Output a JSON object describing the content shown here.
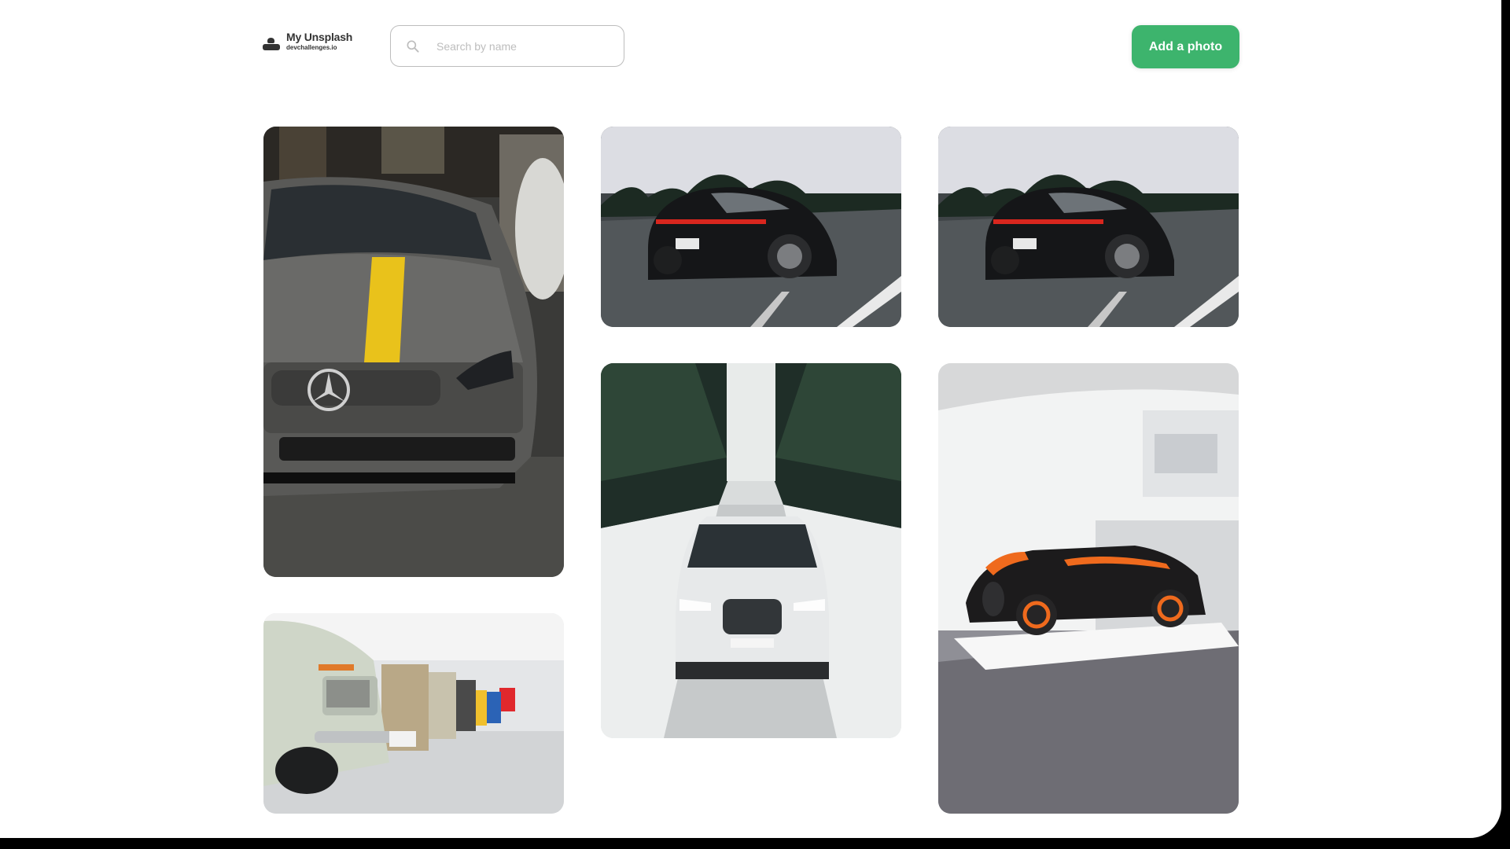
{
  "header": {
    "logo_title": "My Unsplash",
    "logo_subtitle": "devchallenges.io",
    "search_placeholder": "Search by name",
    "add_button_label": "Add a photo"
  },
  "icons": {
    "logo": "person-icon",
    "search": "search-icon"
  },
  "colors": {
    "accent": "#3DB46D",
    "border": "#BDBDBD",
    "text": "#333333"
  },
  "gallery": {
    "photos": [
      {
        "subject": "grey-mercedes-yellow-stripe"
      },
      {
        "subject": "black-porsche-road"
      },
      {
        "subject": "black-porsche-road"
      },
      {
        "subject": "white-audi-snow-forest"
      },
      {
        "subject": "bugatti-showroom"
      },
      {
        "subject": "vintage-bmw-row"
      }
    ]
  }
}
